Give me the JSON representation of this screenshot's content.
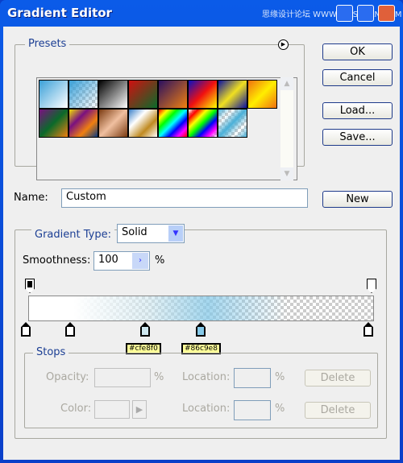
{
  "window": {
    "title": "Gradient Editor",
    "watermark": "思缘设计论坛 WWW.MISSYUAN.COM"
  },
  "presets": {
    "legend": "Presets",
    "swatches": [
      [
        "#3aa0d8",
        "#ffffff"
      ],
      [
        "#3aa0d8",
        "transparent"
      ],
      [
        "#000000",
        "#ffffff"
      ],
      [
        "#d01010",
        "#0a6a2a"
      ],
      [
        "#2a1060",
        "#f08010"
      ],
      [
        "#0a10c0",
        "#f01010",
        "#ffff00"
      ],
      [
        "#0a10a0",
        "#f0e020",
        "#0a10a0"
      ],
      [
        "#f07010",
        "#ffee00",
        "#f07010"
      ],
      [
        "#7a1080",
        "#0a6a2a",
        "#f08010"
      ],
      [
        "#f0e000",
        "#7a1080",
        "#f08010",
        "#0a3a80"
      ],
      [
        "#7a3a10",
        "#f0c0a0",
        "#7a3a10"
      ],
      [
        "#3a80c8",
        "#ffffff",
        "#c08a20",
        "#ffffff"
      ],
      [
        "#ff0000",
        "#ffff00",
        "#00ff00",
        "#00ffff",
        "#0000ff",
        "#ff00ff",
        "#ff0000"
      ],
      [
        "transparent",
        "#ff0000",
        "#ffff00",
        "#00ff00",
        "#0000ff",
        "#ff00ff",
        "transparent"
      ],
      [
        "#4ab0d8",
        "transparent",
        "#4ab0d8",
        "transparent",
        "#4ab0d8"
      ]
    ]
  },
  "buttons": {
    "ok": "OK",
    "cancel": "Cancel",
    "load": "Load...",
    "save": "Save...",
    "new": "New"
  },
  "name": {
    "label": "Name:",
    "value": "Custom"
  },
  "gradient": {
    "type_label": "Gradient Type:",
    "type_value": "Solid",
    "smoothness_label": "Smoothness:",
    "smoothness_value": "100",
    "percent": "%"
  },
  "color_stops": [
    {
      "color": "#ffffff"
    },
    {
      "color": "#ffffff"
    },
    {
      "color": "#cfe8f0",
      "tooltip": "#cfe8f0"
    },
    {
      "color": "#86c9e8",
      "tooltip": "#86c9e8"
    },
    {
      "color": "#ffffff"
    }
  ],
  "stops": {
    "legend": "Stops",
    "opacity_label": "Opacity:",
    "color_label": "Color:",
    "location_label": "Location:",
    "percent": "%",
    "delete": "Delete"
  }
}
